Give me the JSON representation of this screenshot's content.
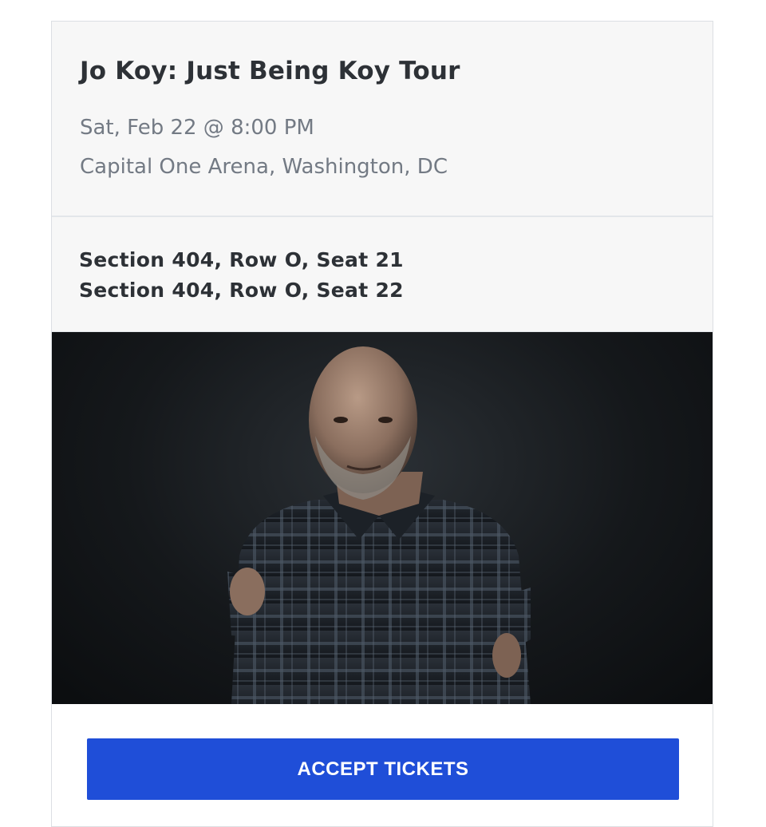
{
  "event": {
    "title": "Jo Koy: Just Being Koy Tour",
    "date": "Sat, Feb 22 @ 8:00 PM",
    "venue": "Capital One Arena, Washington, DC"
  },
  "seats": [
    "Section 404, Row O, Seat 21",
    "Section 404, Row O, Seat 22"
  ],
  "photo": {
    "icon": "performer-photo"
  },
  "actions": {
    "accept_label": "ACCEPT TICKETS"
  },
  "colors": {
    "accent": "#1f4ed8",
    "header_bg": "#f7f7f7",
    "title_text": "#2d3136",
    "muted_text": "#737a84"
  }
}
